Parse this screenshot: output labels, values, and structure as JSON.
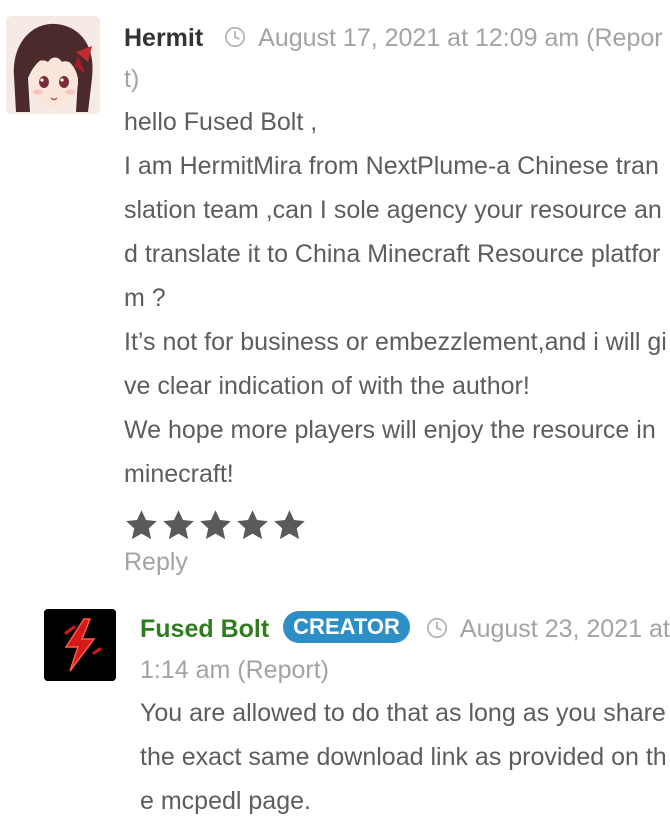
{
  "comments": [
    {
      "author": "Hermit",
      "date": "August 17, 2021 at 12:09 am",
      "report_label": "(Report)",
      "lines": [
        "hello Fused Bolt ,",
        "I am HermitMira from NextPlume-a Chinese translation team ,can I sole agency your resource and translate it to China Minecraft Resource platform ?",
        "It’s not for business or embezzlement,and i will give clear indication of with the author!",
        "We hope more players will enjoy the resource in minecraft!"
      ],
      "rating": 5,
      "reply_label": "Reply"
    },
    {
      "author": "Fused Bolt",
      "badge": "CREATOR",
      "date": "August 23, 2021 at 1:14 am",
      "report_label": "(Report)",
      "lines": [
        "You are allowed to do that as long as you share the exact same download link as provided on the mcpedl page."
      ]
    }
  ],
  "colors": {
    "author_text": "#333333",
    "creator_author": "#2f7d1f",
    "creator_badge": "#2e8fc7",
    "muted": "#a3a3a3",
    "body_text": "#5d5d5d",
    "star": "#5a5a5a"
  },
  "icons": {
    "clock": "clock-icon",
    "star": "star-icon",
    "hermit_avatar": "anime-girl-avatar",
    "fused_avatar": "red-lightning-bolt-logo"
  }
}
